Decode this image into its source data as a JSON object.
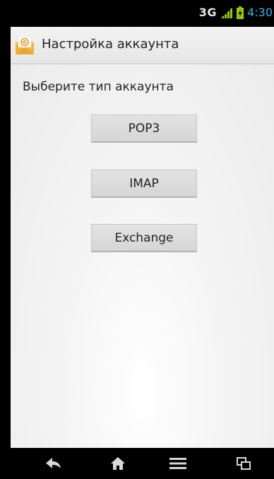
{
  "status_bar": {
    "network": "3G",
    "time": "4:30"
  },
  "action_bar": {
    "title": "Настройка аккаунта",
    "icon": "email-app-icon"
  },
  "content": {
    "prompt": "Выберите тип аккаунта",
    "account_types": [
      "POP3",
      "IMAP",
      "Exchange"
    ]
  },
  "nav_bar": {
    "buttons": [
      "back-icon",
      "home-icon",
      "menu-icon",
      "recent-apps-icon"
    ]
  },
  "colors": {
    "clock": "#33b5e5",
    "signal": "#99cc00",
    "button_bg": "#dcdcdc"
  }
}
